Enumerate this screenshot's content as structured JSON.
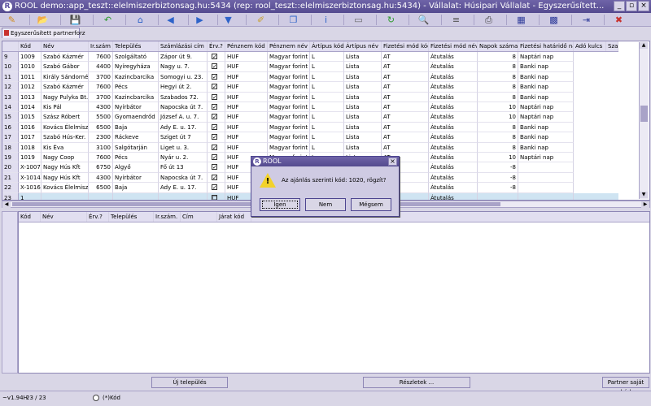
{
  "window": {
    "title": "ROOL demo::app_teszt::elelmiszerbiztonsag.hu:5434 (rep: rool_teszt::elelmiszerbiztonsag.hu:5434) - Vállalat: Húsipari Vállalat - Egyszerűsített...",
    "app_icon_text": "R",
    "minimize": "_",
    "restore": "▫",
    "close": "×"
  },
  "toolbar": {
    "icons": [
      "edit-icon",
      "open-icon",
      "save-icon",
      "undo-icon",
      "home-icon",
      "prev-icon",
      "next-icon",
      "down-icon",
      "pencil-icon",
      "copy-icon",
      "info-icon",
      "form-icon",
      "refresh-icon",
      "search-icon",
      "list-icon",
      "print-icon",
      "grid-icon",
      "grid-edit-icon",
      "export-icon",
      "exit-icon"
    ],
    "glyphs": [
      "✎",
      "📂",
      "💾",
      "↶",
      "⌂",
      "◀",
      "▶",
      "▼",
      "✐",
      "❐",
      "i",
      "▭",
      "↻",
      "🔍",
      "≡",
      "⎙",
      "▦",
      "▩",
      "⇥",
      "✖"
    ],
    "colors": [
      "#d08a1a",
      "#3a78c8",
      "#333399",
      "#2d9a2d",
      "#2d63c9",
      "#2d63c9",
      "#2d63c9",
      "#2d63c9",
      "#c8a02d",
      "#2d63c9",
      "#2d63c9",
      "#666",
      "#2d9a2d",
      "#555",
      "#555",
      "#444",
      "#2d3a99",
      "#2d3a99",
      "#2d3a99",
      "#c8322d"
    ]
  },
  "tab": {
    "label": "Egyszerűsített partnerforz"
  },
  "grid": {
    "columns": [
      "",
      "Kód",
      "Név",
      "Ir.szám",
      "Település",
      "Számlázási cím",
      "Érv.?",
      "Pénznem kód",
      "Pénznem név",
      "Ártípus kód",
      "Ártípus név",
      "Fizetési mód kód",
      "Fizetési mód név",
      "Napok száma",
      "Fizetési határidő nap típus",
      "Adó kulcs",
      "Sza"
    ],
    "rows": [
      [
        "9",
        "1009",
        "Szabó Kázmér",
        "7600",
        "Szolgáltató",
        "Zápor út 9.",
        "✓",
        "HUF",
        "Magyar forint",
        "L",
        "Lista",
        "AT",
        "Átutalás",
        "8",
        "Naptári nap"
      ],
      [
        "10",
        "1010",
        "Szabó Gábor",
        "4400",
        "Nyíregyháza",
        "Nagy u. 7.",
        "✓",
        "HUF",
        "Magyar forint",
        "L",
        "Lista",
        "AT",
        "Átutalás",
        "8",
        "Banki nap"
      ],
      [
        "11",
        "1011",
        "Király Sándorné",
        "3700",
        "Kazincbarcika",
        "Somogyi u. 23.",
        "✓",
        "HUF",
        "Magyar forint",
        "L",
        "Lista",
        "AT",
        "Átutalás",
        "8",
        "Banki nap"
      ],
      [
        "12",
        "1012",
        "Szabó Kázmér",
        "7600",
        "Pécs",
        "Hegyi út 2.",
        "✓",
        "HUF",
        "Magyar forint",
        "L",
        "Lista",
        "AT",
        "Átutalás",
        "8",
        "Banki nap"
      ],
      [
        "13",
        "1013",
        "Nagy Pulyka Bt.",
        "3700",
        "Kazincbarcika",
        "Szabados 72.",
        "✓",
        "HUF",
        "Magyar forint",
        "L",
        "Lista",
        "AT",
        "Átutalás",
        "8",
        "Banki nap"
      ],
      [
        "14",
        "1014",
        "Kis Pál",
        "4300",
        "Nyírbátor",
        "Napocska út 7.",
        "✓",
        "HUF",
        "Magyar forint",
        "L",
        "Lista",
        "AT",
        "Átutalás",
        "10",
        "Naptári nap"
      ],
      [
        "15",
        "1015",
        "Szász Róbert",
        "5500",
        "Gyomaendrőd",
        "József A. u. 7.",
        "✓",
        "HUF",
        "Magyar forint",
        "L",
        "Lista",
        "AT",
        "Átutalás",
        "10",
        "Naptári nap"
      ],
      [
        "16",
        "1016",
        "Kovács Élelmiszer Kft.",
        "6500",
        "Baja",
        "Ady E. u. 17.",
        "✓",
        "HUF",
        "Magyar forint",
        "L",
        "Lista",
        "AT",
        "Átutalás",
        "8",
        "Banki nap"
      ],
      [
        "17",
        "1017",
        "Szabó Hús-Ker.",
        "2300",
        "Ráckeve",
        "Sziget út 7",
        "✓",
        "HUF",
        "Magyar forint",
        "L",
        "Lista",
        "AT",
        "Átutalás",
        "8",
        "Banki nap"
      ],
      [
        "18",
        "1018",
        "Kis Éva",
        "3100",
        "Salgótarján",
        "Liget u. 3.",
        "✓",
        "HUF",
        "Magyar forint",
        "L",
        "Lista",
        "AT",
        "Átutalás",
        "8",
        "Banki nap"
      ],
      [
        "19",
        "1019",
        "Nagy Coop",
        "7600",
        "Pécs",
        "Nyár u. 2.",
        "✓",
        "HUF",
        "Magyar forint",
        "L",
        "Lista",
        "AT",
        "Átutalás",
        "10",
        "Naptári nap"
      ],
      [
        "20",
        "X-1007",
        "Nagy Hús Kft",
        "6750",
        "Algyő",
        "Fő út 13",
        "✓",
        "HUF",
        "",
        "",
        "",
        "",
        "Átutalás",
        "-8",
        ""
      ],
      [
        "21",
        "X-1014",
        "Nagy Hús Kft",
        "4300",
        "Nyírbátor",
        "Napocska út 7.",
        "✓",
        "HUF",
        "",
        "",
        "",
        "",
        "Átutalás",
        "-8",
        ""
      ],
      [
        "22",
        "X-1016",
        "Kovács Élelmiszer Kft.",
        "6500",
        "Baja",
        "Ady E. u. 17.",
        "✓",
        "HUF",
        "",
        "",
        "",
        "",
        "Átutalás",
        "-8",
        ""
      ],
      [
        "23",
        "1",
        "",
        "",
        "",
        "",
        "☐",
        "HUF",
        "",
        "",
        "",
        "",
        "Átutalás",
        "",
        ""
      ]
    ]
  },
  "detail_grid": {
    "columns": [
      "Kód",
      "Név",
      "Érv.?",
      "Település",
      "Ir.szám.",
      "Cím",
      "Járat kód"
    ]
  },
  "buttons": {
    "new_settlement": "Új település",
    "details": "Részletek ...",
    "partner_own_code": "Partner saját kód"
  },
  "status": {
    "version": "~v1.94H",
    "record": "23 / 23",
    "radio_label": "(*)Kód"
  },
  "dialog": {
    "title": "ROOL",
    "icon_text": "R",
    "close": "×",
    "message": "Az ajánlás szerinti kód: 1020, rögzít?",
    "warn_mark": "!",
    "yes": "Igen",
    "no": "Nem",
    "cancel": "Mégsem"
  }
}
